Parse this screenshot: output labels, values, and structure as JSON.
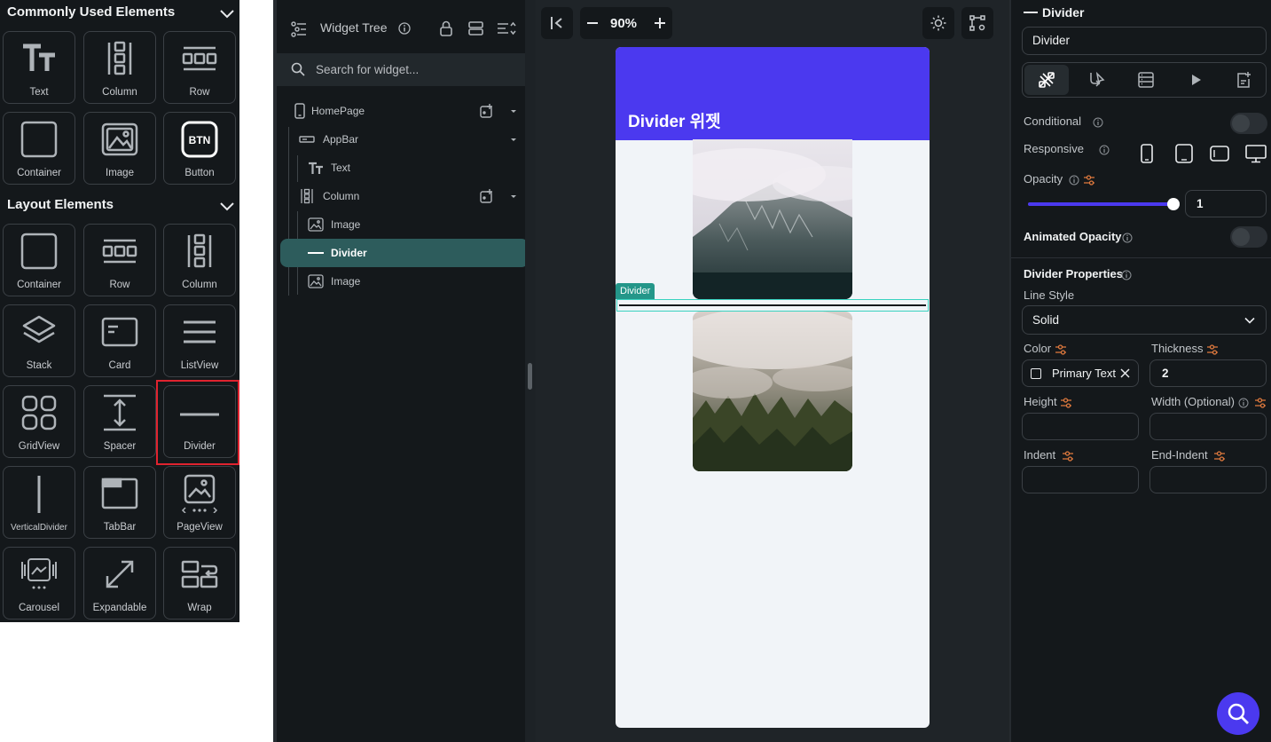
{
  "palette": {
    "common_title": "Commonly Used Elements",
    "common_items": [
      {
        "label": "Text",
        "icon": "text-icon"
      },
      {
        "label": "Column",
        "icon": "column-icon"
      },
      {
        "label": "Row",
        "icon": "row-icon"
      },
      {
        "label": "Container",
        "icon": "container-icon"
      },
      {
        "label": "Image",
        "icon": "image-icon"
      },
      {
        "label": "Button",
        "icon": "button-icon",
        "badge": "BTN"
      }
    ],
    "layout_title": "Layout Elements",
    "layout_items": [
      {
        "label": "Container",
        "icon": "container-icon"
      },
      {
        "label": "Row",
        "icon": "row-icon"
      },
      {
        "label": "Column",
        "icon": "column-icon"
      },
      {
        "label": "Stack",
        "icon": "stack-icon"
      },
      {
        "label": "Card",
        "icon": "card-icon"
      },
      {
        "label": "ListView",
        "icon": "listview-icon"
      },
      {
        "label": "GridView",
        "icon": "gridview-icon"
      },
      {
        "label": "Spacer",
        "icon": "spacer-icon"
      },
      {
        "label": "Divider",
        "icon": "divider-icon"
      },
      {
        "label": "VerticalDivider",
        "icon": "vertical-divider-icon"
      },
      {
        "label": "TabBar",
        "icon": "tabbar-icon"
      },
      {
        "label": "PageView",
        "icon": "pageview-icon"
      },
      {
        "label": "Carousel",
        "icon": "carousel-icon"
      },
      {
        "label": "Expandable",
        "icon": "expandable-icon"
      },
      {
        "label": "Wrap",
        "icon": "wrap-icon"
      }
    ],
    "highlight_color": "#e0232f"
  },
  "tree": {
    "title": "Widget Tree",
    "search_placeholder": "Search for widget...",
    "nodes": [
      {
        "label": "HomePage",
        "icon": "phone-icon"
      },
      {
        "label": "AppBar",
        "icon": "appbar-icon"
      },
      {
        "label": "Text",
        "icon": "text-icon"
      },
      {
        "label": "Column",
        "icon": "column-icon"
      },
      {
        "label": "Image",
        "icon": "image-icon"
      },
      {
        "label": "Divider",
        "icon": "divider-icon",
        "selected": true
      },
      {
        "label": "Image",
        "icon": "image-icon"
      }
    ],
    "selected_color": "#2d5c5c"
  },
  "canvas": {
    "zoom": "90%",
    "appbar_title": "Divider 위젯",
    "appbar_color": "#4b39ef",
    "selection_tag": "Divider"
  },
  "props": {
    "header": "Divider",
    "name_value": "Divider",
    "conditional_label": "Conditional",
    "responsive_label": "Responsive",
    "opacity_label": "Opacity",
    "opacity_value": "1",
    "opacity_level": 1,
    "animated_opacity_label": "Animated Opacity",
    "section_title": "Divider Properties",
    "line_style_label": "Line Style",
    "line_style_value": "Solid",
    "color_label": "Color",
    "color_value": "Primary Text",
    "thickness_label": "Thickness",
    "thickness_value": "2",
    "height_label": "Height",
    "width_label": "Width (Optional)",
    "indent_label": "Indent",
    "end_indent_label": "End-Indent"
  }
}
